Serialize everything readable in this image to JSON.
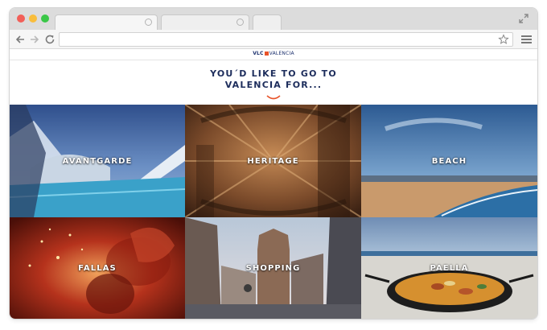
{
  "browser": {
    "icons": {
      "back": "arrow-left-icon",
      "forward": "arrow-right-icon",
      "reload": "reload-icon",
      "bookmark": "star-icon",
      "menu": "hamburger-menu-icon",
      "fullscreen": "expand-icon"
    },
    "url": ""
  },
  "site": {
    "logo": {
      "prefix": "VLC",
      "name": "VALENCIA",
      "accent_color": "#e8542a"
    },
    "headline_line1": "YOU´D LIKE TO GO TO",
    "headline_line2": "VALENCIA FOR...",
    "accent_color": "#e8542a",
    "headline_color": "#1d2d5c"
  },
  "categories": [
    {
      "label": "AVANTGARDE"
    },
    {
      "label": "HERITAGE"
    },
    {
      "label": "BEACH"
    },
    {
      "label": "FALLAS"
    },
    {
      "label": "SHOPPING"
    },
    {
      "label": "PAELLA"
    }
  ]
}
